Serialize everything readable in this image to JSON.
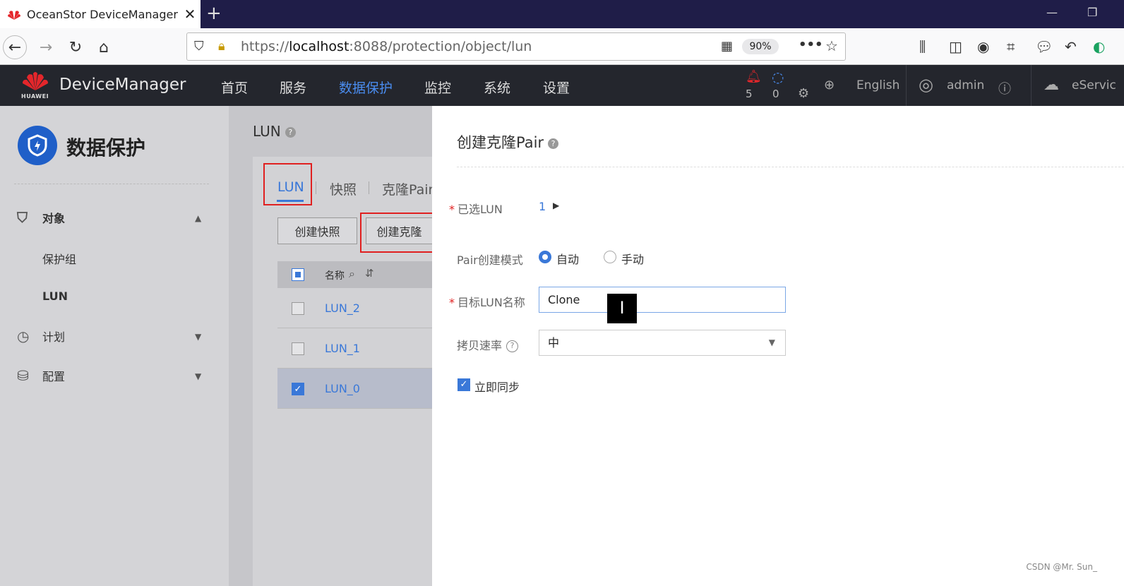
{
  "browser": {
    "tab_title": "OceanStor DeviceManager",
    "url_prefix": "https://",
    "url_host": "localhost",
    "url_rest": ":8088/protection/object/lun",
    "zoom": "90%"
  },
  "header": {
    "app_name": "DeviceManager",
    "brand_text": "HUAWEI",
    "menu": [
      "首页",
      "服务",
      "数据保护",
      "监控",
      "系统",
      "设置"
    ],
    "active_menu": "数据保护",
    "alarm_count": "5",
    "task_count": "0",
    "language": "English",
    "user": "admin",
    "eservice": "eServic"
  },
  "sidebar": {
    "title": "数据保护",
    "groups": [
      {
        "label": "对象",
        "items": [
          "保护组",
          "LUN"
        ]
      },
      {
        "label": "计划"
      },
      {
        "label": "配置"
      }
    ]
  },
  "main": {
    "title": "LUN",
    "tabs": [
      "LUN",
      "快照",
      "克隆Pair"
    ],
    "buttons": [
      "创建快照",
      "创建克隆"
    ],
    "column_name": "名称",
    "rows": [
      "LUN_2",
      "LUN_1",
      "LUN_0"
    ]
  },
  "panel": {
    "title": "创建克隆Pair",
    "selected_lun_label": "已选LUN",
    "selected_lun_value": "1",
    "mode_label": "Pair创建模式",
    "mode_auto": "自动",
    "mode_manual": "手动",
    "target_name_label": "目标LUN名称",
    "target_name_value": "Clone",
    "copy_rate_label": "拷贝速率",
    "copy_rate_value": "中",
    "sync_label": "立即同步"
  },
  "watermark": "CSDN @Mr. Sun_",
  "colors": {
    "accent": "#3a78d8",
    "header_bg": "#24262d",
    "highlight": "#e02020"
  }
}
